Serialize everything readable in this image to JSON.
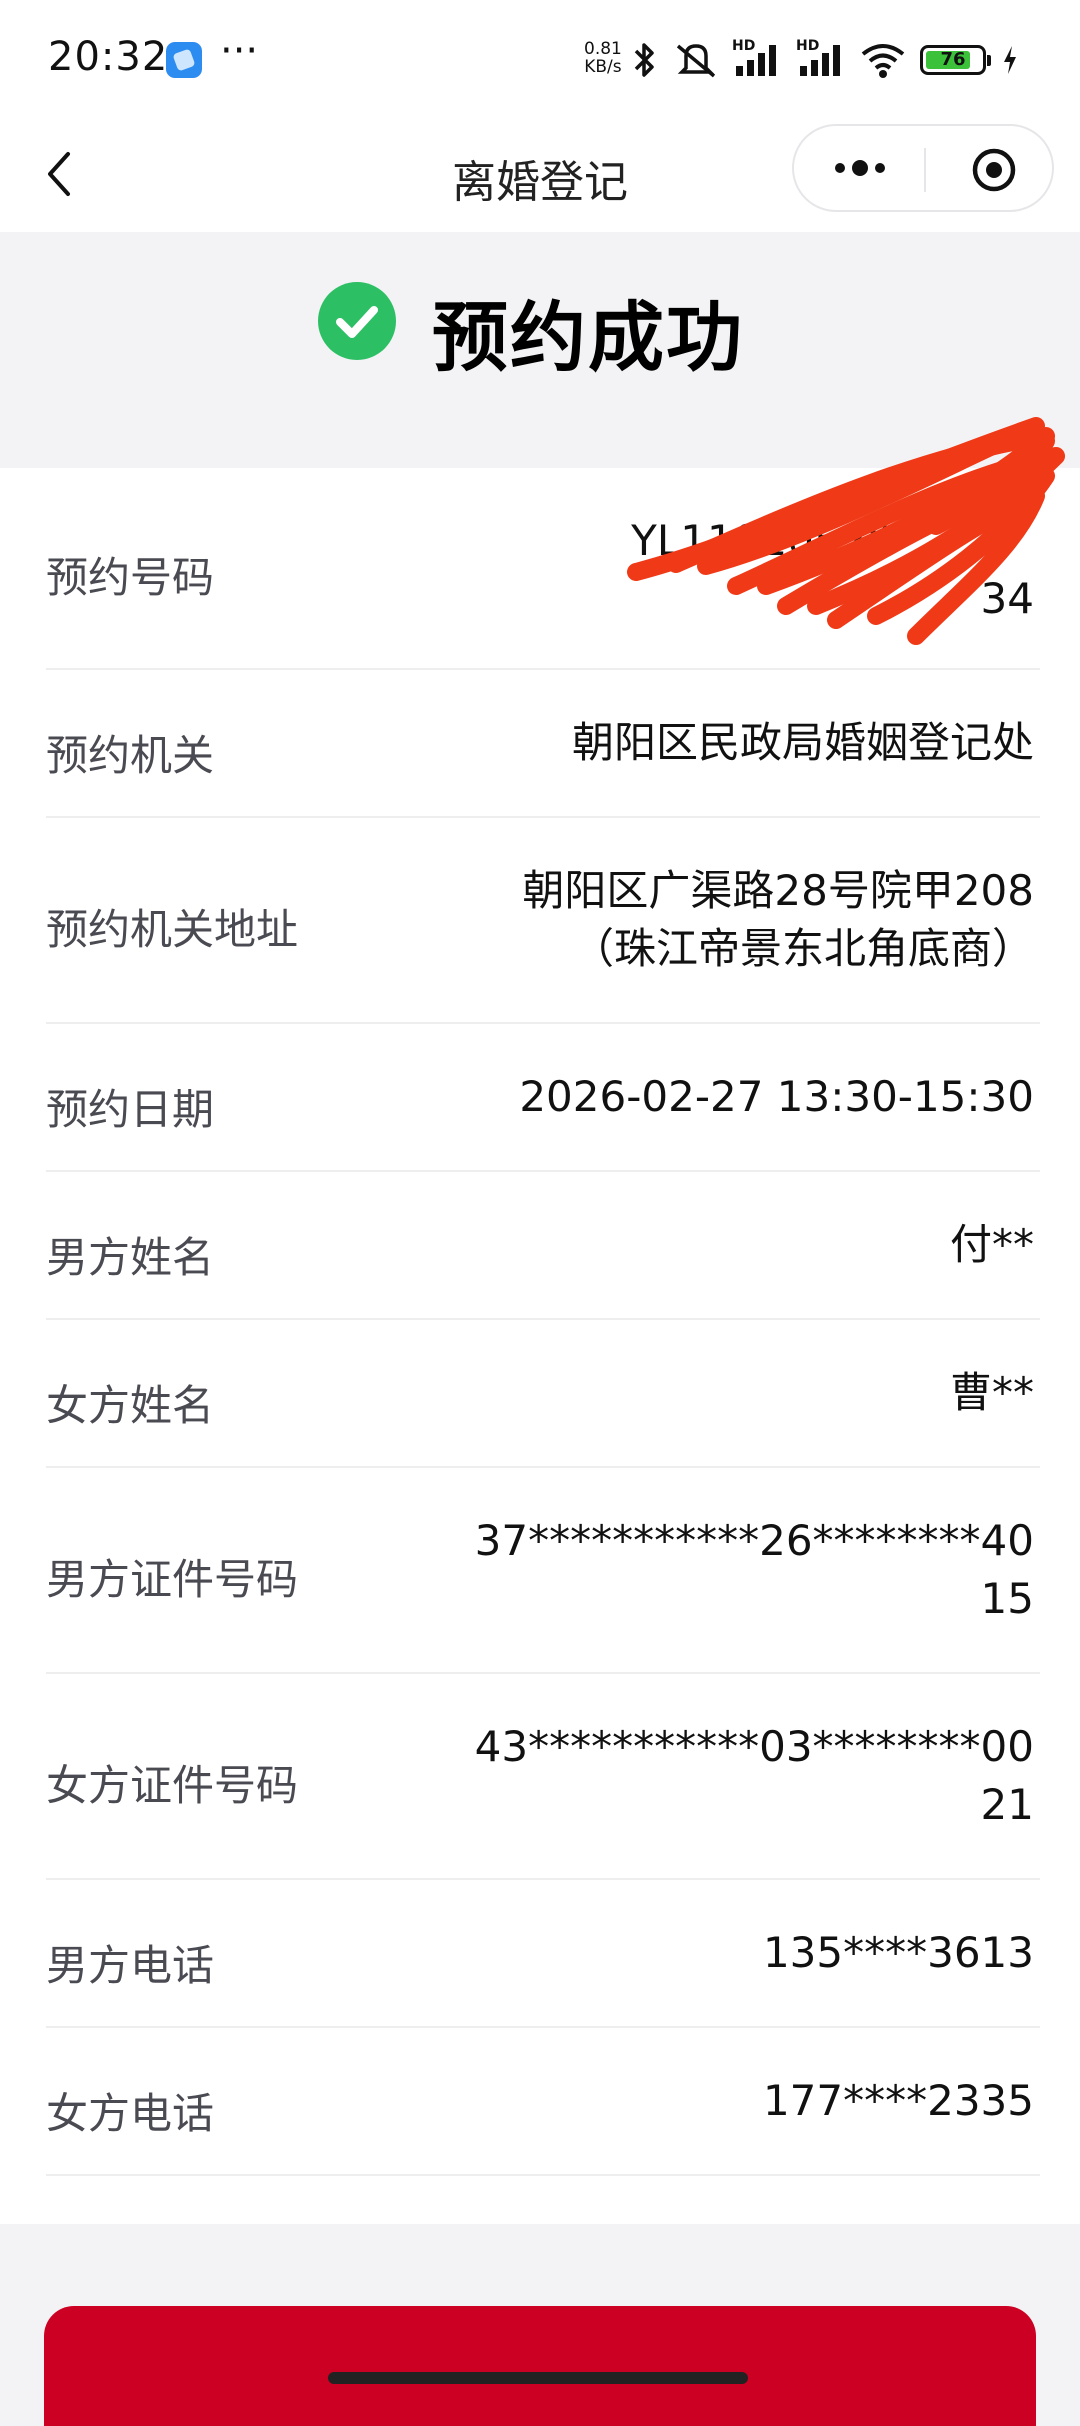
{
  "status_bar": {
    "time": "20:32",
    "net_speed_value": "0.81",
    "net_speed_unit": "KB/s",
    "hd_label": "HD",
    "battery": "76"
  },
  "nav": {
    "title": "离婚登记"
  },
  "result": {
    "title": "预约成功"
  },
  "details": [
    {
      "label": "预约号码",
      "value_line1": "YL11010520",
      "value_line2": "34"
    },
    {
      "label": "预约机关",
      "value_line1": "朝阳区民政局婚姻登记处"
    },
    {
      "label": "预约机关地址",
      "value_line1": "朝阳区广渠路28号院甲208",
      "value_line2": "（珠江帝景东北角底商）"
    },
    {
      "label": "预约日期",
      "value_line1": "2026-02-27 13:30-15:30"
    },
    {
      "label": "男方姓名",
      "value_line1": "付**"
    },
    {
      "label": "女方姓名",
      "value_line1": "曹**"
    },
    {
      "label": "男方证件号码",
      "value_line1": "37***********26********40",
      "value_line2": "15"
    },
    {
      "label": "女方证件号码",
      "value_line1": "43***********03********00",
      "value_line2": "21"
    },
    {
      "label": "男方电话",
      "value_line1": "135****3613"
    },
    {
      "label": "女方电话",
      "value_line1": "177****2335"
    }
  ],
  "colors": {
    "success_green": "#2dbf64",
    "primary_red": "#cc0022",
    "redaction": "#f03a17"
  },
  "icons": [
    "back-arrow-icon",
    "more-icon",
    "close-mini-program-icon",
    "check-circle-icon"
  ]
}
